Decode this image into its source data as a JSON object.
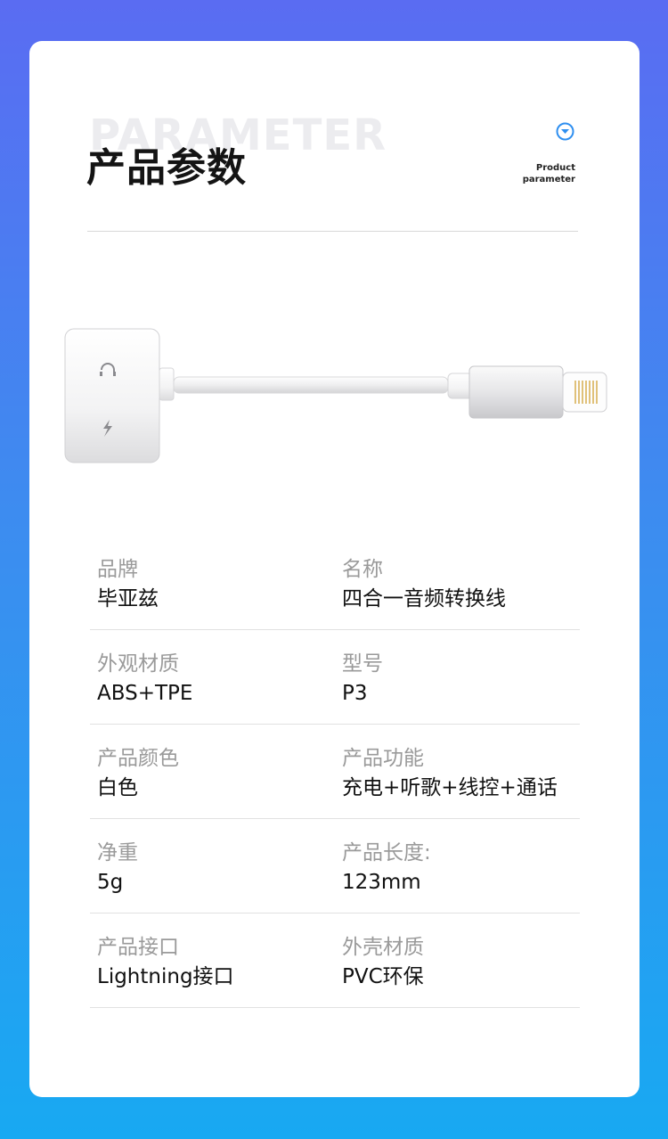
{
  "header": {
    "background_word": "PARAMETER",
    "title": "产品参数",
    "subtitle_line1": "Product",
    "subtitle_line2": "parameter",
    "badge_icon": "chevron-down-circle-icon"
  },
  "colors": {
    "background_top": "#5a6cf2",
    "background_bottom": "#18a9f2",
    "accent": "#2f8ff0",
    "label": "#9a9a9a",
    "value": "#111111"
  },
  "product_image": {
    "icons": [
      "headphone-icon",
      "lightning-bolt-icon"
    ]
  },
  "specs": [
    {
      "left": {
        "label": "品牌",
        "value": "毕亚兹"
      },
      "right": {
        "label": "名称",
        "value": "四合一音频转换线"
      }
    },
    {
      "left": {
        "label": "外观材质",
        "value": "ABS+TPE"
      },
      "right": {
        "label": "型号",
        "value": "P3"
      }
    },
    {
      "left": {
        "label": "产品颜色",
        "value": "白色"
      },
      "right": {
        "label": "产品功能",
        "value": "充电+听歌+线控+通话"
      }
    },
    {
      "left": {
        "label": "净重",
        "value": "5g"
      },
      "right": {
        "label": "产品长度:",
        "value": "123mm"
      }
    },
    {
      "left": {
        "label": "产品接口",
        "value": "Lightning接口"
      },
      "right": {
        "label": "外壳材质",
        "value": "PVC环保"
      }
    }
  ]
}
